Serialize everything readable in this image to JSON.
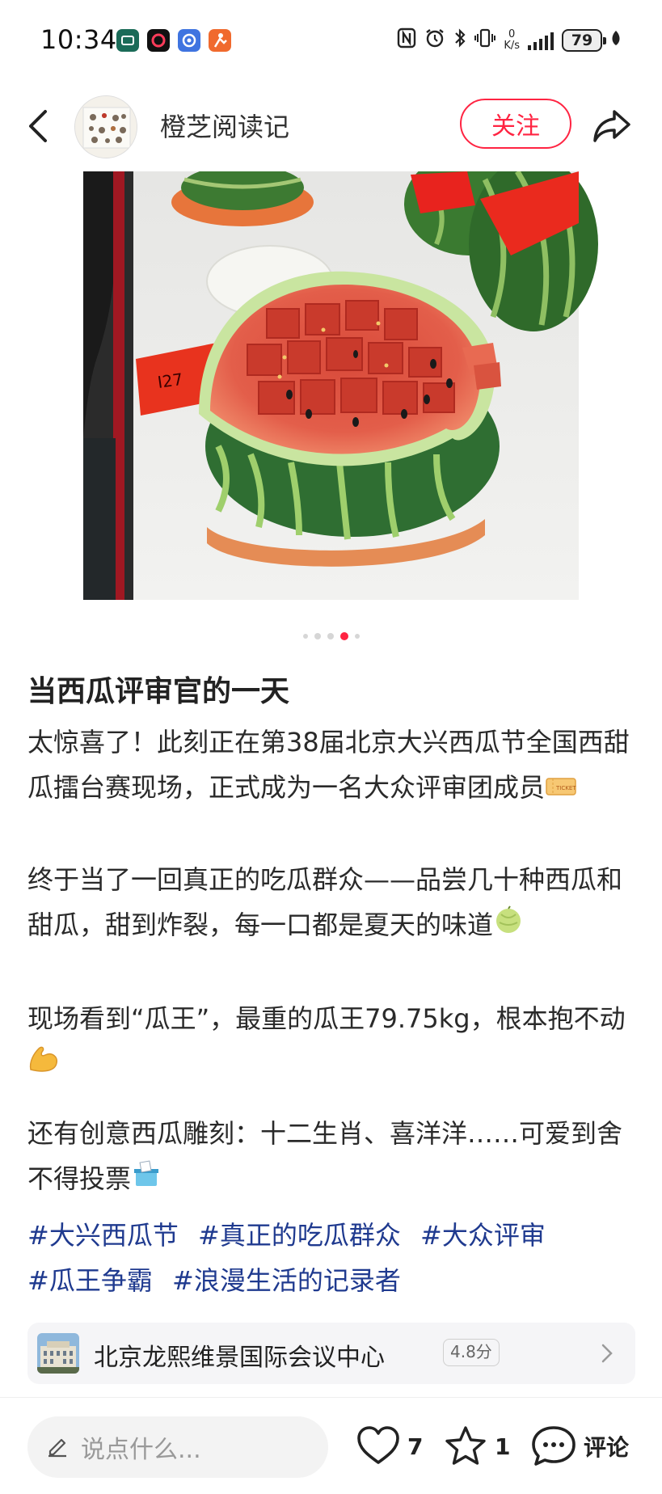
{
  "status_bar": {
    "time": "10:34",
    "net_speed_value": "0",
    "net_speed_unit": "K/s",
    "battery": "79",
    "icons": [
      "app-green-icon",
      "app-black-icon",
      "app-blue-icon",
      "app-orange-icon",
      "nfc-icon",
      "alarm-icon",
      "bluetooth-icon",
      "vibrate-icon",
      "signal-icon",
      "battery-icon",
      "leaf-icon"
    ]
  },
  "header": {
    "author": "橙芝阅读记",
    "follow_label": "关注"
  },
  "carousel": {
    "total": 5,
    "active_index": 3
  },
  "post": {
    "title": "当西瓜评审官的一天",
    "paragraphs": [
      "太惊喜了！此刻正在第38届北京大兴西瓜节全国西甜瓜擂台赛现场，正式成为一名大众评审团成员",
      "终于当了一回真正的吃瓜群众——品尝几十种西瓜和甜瓜，甜到炸裂，每一口都是夏天的味道",
      "现场看到“瓜王”，最重的瓜王79.75kg，根本抱不动",
      "还有创意西瓜雕刻：十二生肖、喜洋洋……可爱到舍不得投票"
    ],
    "emoji_names": [
      "ticket-emoji",
      "melon-emoji",
      "flexed-biceps-emoji",
      "ballot-box-emoji"
    ],
    "tags": [
      "#大兴西瓜节",
      "#真正的吃瓜群众",
      "#大众评审",
      "#瓜王争霸",
      "#浪漫生活的记录者"
    ]
  },
  "location": {
    "name": "北京龙熙维景国际会议中心",
    "rating": "4.8分"
  },
  "bottom_bar": {
    "comment_placeholder": "说点什么...",
    "likes": "7",
    "collects": "1",
    "comment_label": "评论"
  },
  "colors": {
    "accent": "#ff2442",
    "tag": "#1f3a8f",
    "text": "#222222",
    "muted": "#999999"
  }
}
